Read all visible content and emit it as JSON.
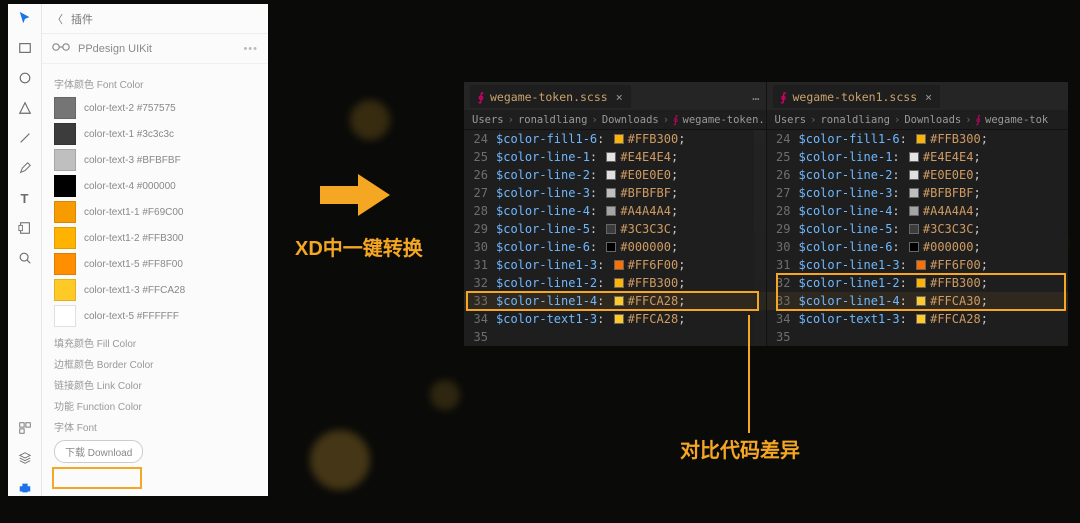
{
  "xd": {
    "plugins_label": "插件",
    "plugin_name": "PPdesign UIKit",
    "section_font_color": "字体颜色 Font Color",
    "swatches": [
      {
        "label": "color-text-2 #757575",
        "color": "#757575"
      },
      {
        "label": "color-text-1 #3c3c3c",
        "color": "#3c3c3c"
      },
      {
        "label": "color-text-3 #BFBFBF",
        "color": "#BFBFBF"
      },
      {
        "label": "color-text-4 #000000",
        "color": "#000000"
      },
      {
        "label": "color-text1-1 #F69C00",
        "color": "#F69C00"
      },
      {
        "label": "color-text1-2 #FFB300",
        "color": "#FFB300"
      },
      {
        "label": "color-text1-5 #FF8F00",
        "color": "#FF8F00"
      },
      {
        "label": "color-text1-3 #FFCA28",
        "color": "#FFCA28"
      },
      {
        "label": "color-text-5 #FFFFFF",
        "color": "#FFFFFF"
      }
    ],
    "section_fill": "填充颜色 Fill Color",
    "section_border": "边框颜色 Border Color",
    "section_link": "链接颜色 Link Color",
    "section_function": "功能 Function Color",
    "section_font": "字体 Font",
    "download_label": "下载 Download"
  },
  "annot": {
    "line1": "XD中一键转换",
    "line2": "对比代码差异"
  },
  "editor": {
    "left": {
      "tab": "wegame-token.scss",
      "crumbs": [
        "Users",
        "ronaldliang",
        "Downloads",
        "wegame-token.sc"
      ],
      "lines": [
        {
          "n": 24,
          "var": "$color-fill1-6",
          "hex": "#FFB300"
        },
        {
          "n": 25,
          "var": "$color-line-1",
          "hex": "#E4E4E4"
        },
        {
          "n": 26,
          "var": "$color-line-2",
          "hex": "#E0E0E0"
        },
        {
          "n": 27,
          "var": "$color-line-3",
          "hex": "#BFBFBF"
        },
        {
          "n": 28,
          "var": "$color-line-4",
          "hex": "#A4A4A4"
        },
        {
          "n": 29,
          "var": "$color-line-5",
          "hex": "#3C3C3C"
        },
        {
          "n": 30,
          "var": "$color-line-6",
          "hex": "#000000"
        },
        {
          "n": 31,
          "var": "$color-line1-3",
          "hex": "#FF6F00"
        },
        {
          "n": 32,
          "var": "$color-line1-2",
          "hex": "#FFB300"
        },
        {
          "n": 33,
          "var": "$color-line1-4",
          "hex": "#FFCA28"
        },
        {
          "n": 34,
          "var": "$color-text1-3",
          "hex": "#FFCA28"
        },
        {
          "n": 35,
          "var": "",
          "hex": ""
        }
      ]
    },
    "right": {
      "tab": "wegame-token1.scss",
      "crumbs": [
        "Users",
        "ronaldliang",
        "Downloads",
        "wegame-tok"
      ],
      "lines": [
        {
          "n": 24,
          "var": "$color-fill1-6",
          "hex": "#FFB300"
        },
        {
          "n": 25,
          "var": "$color-line-1",
          "hex": "#E4E4E4"
        },
        {
          "n": 26,
          "var": "$color-line-2",
          "hex": "#E0E0E0"
        },
        {
          "n": 27,
          "var": "$color-line-3",
          "hex": "#BFBFBF"
        },
        {
          "n": 28,
          "var": "$color-line-4",
          "hex": "#A4A4A4"
        },
        {
          "n": 29,
          "var": "$color-line-5",
          "hex": "#3C3C3C"
        },
        {
          "n": 30,
          "var": "$color-line-6",
          "hex": "#000000"
        },
        {
          "n": 31,
          "var": "$color-line1-3",
          "hex": "#FF6F00"
        },
        {
          "n": 32,
          "var": "$color-line1-2",
          "hex": "#FFB300"
        },
        {
          "n": 33,
          "var": "$color-line1-4",
          "hex": "#FFCA30"
        },
        {
          "n": 34,
          "var": "$color-text1-3",
          "hex": "#FFCA28"
        },
        {
          "n": 35,
          "var": "",
          "hex": ""
        }
      ]
    }
  }
}
